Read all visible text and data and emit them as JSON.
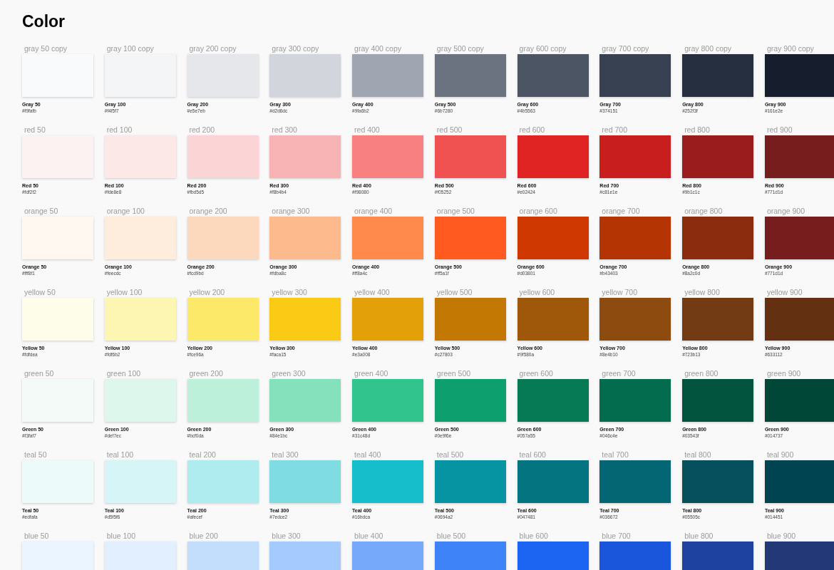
{
  "title": "Color",
  "rows": [
    {
      "swatches": [
        {
          "label": "gray 50 copy",
          "name": "Gray 50",
          "hex": "#f9fafb",
          "color": "#f9fafb"
        },
        {
          "label": "gray 100 copy",
          "name": "Gray 100",
          "hex": "#f4f5f7",
          "color": "#f4f5f7"
        },
        {
          "label": "gray 200 copy",
          "name": "Gray 200",
          "hex": "#e5e7eb",
          "color": "#e5e7eb"
        },
        {
          "label": "gray 300 copy",
          "name": "Gray 300",
          "hex": "#d2d6dc",
          "color": "#d2d6dc"
        },
        {
          "label": "gray 400 copy",
          "name": "Gray 400",
          "hex": "#9fa6b2",
          "color": "#9fa6b2"
        },
        {
          "label": "gray 500 copy",
          "name": "Gray 500",
          "hex": "#6b7280",
          "color": "#6b7280"
        },
        {
          "label": "gray 600 copy",
          "name": "Gray 600",
          "hex": "#4b5563",
          "color": "#4b5563"
        },
        {
          "label": "gray 700 copy",
          "name": "Gray 700",
          "hex": "#374151",
          "color": "#374151"
        },
        {
          "label": "gray 800 copy",
          "name": "Gray 800",
          "hex": "#252f3f",
          "color": "#252f3f"
        },
        {
          "label": "gray 900 copy",
          "name": "Gray 900",
          "hex": "#161e2e",
          "color": "#161e2e"
        }
      ]
    },
    {
      "swatches": [
        {
          "label": "red 50",
          "name": "Red 50",
          "hex": "#fdf2f2",
          "color": "#fdf2f2"
        },
        {
          "label": "red 100",
          "name": "Red 100",
          "hex": "#fde8e8",
          "color": "#fde8e8"
        },
        {
          "label": "red 200",
          "name": "Red 200",
          "hex": "#fbd5d5",
          "color": "#fbd5d5"
        },
        {
          "label": "red 300",
          "name": "Red 300",
          "hex": "#f8b4b4",
          "color": "#f8b4b4"
        },
        {
          "label": "red 400",
          "name": "Red 400",
          "hex": "#f98080",
          "color": "#f98080"
        },
        {
          "label": "red 500",
          "name": "Red 500",
          "hex": "#f05252",
          "color": "#f05252"
        },
        {
          "label": "red 600",
          "name": "Red 600",
          "hex": "#e02424",
          "color": "#e02424"
        },
        {
          "label": "red 700",
          "name": "Red 700",
          "hex": "#c81e1e",
          "color": "#c81e1e"
        },
        {
          "label": "red 800",
          "name": "Red 800",
          "hex": "#9b1c1c",
          "color": "#9b1c1c"
        },
        {
          "label": "red 900",
          "name": "Red 900",
          "hex": "#771d1d",
          "color": "#771d1d"
        }
      ]
    },
    {
      "swatches": [
        {
          "label": "orange 50",
          "name": "Orange 50",
          "hex": "#fff8f1",
          "color": "#fff8f1"
        },
        {
          "label": "orange 100",
          "name": "Orange 100",
          "hex": "#feecdc",
          "color": "#feecdc"
        },
        {
          "label": "orange 200",
          "name": "Orange 200",
          "hex": "#fcd9bd",
          "color": "#fcd9bd"
        },
        {
          "label": "orange 300",
          "name": "Orange 300",
          "hex": "#fdba8c",
          "color": "#fdba8c"
        },
        {
          "label": "orange 400",
          "name": "Orange 400",
          "hex": "#ff8a4c",
          "color": "#ff8a4c"
        },
        {
          "label": "orange 500",
          "name": "Orange 500",
          "hex": "#ff5a1f",
          "color": "#ff5a1f"
        },
        {
          "label": "orange 600",
          "name": "Orange 600",
          "hex": "#d03801",
          "color": "#d03801"
        },
        {
          "label": "orange 700",
          "name": "Orange 700",
          "hex": "#b43403",
          "color": "#b43403"
        },
        {
          "label": "orange 800",
          "name": "Orange 800",
          "hex": "#8a2c0d",
          "color": "#8a2c0d"
        },
        {
          "label": "orange 900",
          "name": "Orange 900",
          "hex": "#771d1d",
          "color": "#771d1d"
        }
      ]
    },
    {
      "swatches": [
        {
          "label": "yellow 50",
          "name": "Yellow 50",
          "hex": "#fdfdea",
          "color": "#fdfdea"
        },
        {
          "label": "yellow 100",
          "name": "Yellow 100",
          "hex": "#fdf6b2",
          "color": "#fdf6b2"
        },
        {
          "label": "yellow 200",
          "name": "Yellow 200",
          "hex": "#fce96a",
          "color": "#fce96a"
        },
        {
          "label": "yellow 300",
          "name": "Yellow 300",
          "hex": "#faca15",
          "color": "#faca15"
        },
        {
          "label": "yellow 400",
          "name": "Yellow 400",
          "hex": "#e3a008",
          "color": "#e3a008"
        },
        {
          "label": "yellow 500",
          "name": "Yellow 500",
          "hex": "#c27803",
          "color": "#c27803"
        },
        {
          "label": "yellow 600",
          "name": "Yellow 600",
          "hex": "#9f580a",
          "color": "#9f580a"
        },
        {
          "label": "yellow 700",
          "name": "Yellow 700",
          "hex": "#8e4b10",
          "color": "#8e4b10"
        },
        {
          "label": "yellow 800",
          "name": "Yellow 800",
          "hex": "#723b13",
          "color": "#723b13"
        },
        {
          "label": "yellow 900",
          "name": "Yellow 900",
          "hex": "#633112",
          "color": "#633112"
        }
      ]
    },
    {
      "swatches": [
        {
          "label": "green 50",
          "name": "Green 50",
          "hex": "#f3faf7",
          "color": "#f3faf7"
        },
        {
          "label": "green 100",
          "name": "Green 100",
          "hex": "#def7ec",
          "color": "#def7ec"
        },
        {
          "label": "green 200",
          "name": "Green 200",
          "hex": "#bcf0da",
          "color": "#bcf0da"
        },
        {
          "label": "green 300",
          "name": "Green 300",
          "hex": "#84e1bc",
          "color": "#84e1bc"
        },
        {
          "label": "green 400",
          "name": "Green 400",
          "hex": "#31c48d",
          "color": "#31c48d"
        },
        {
          "label": "green 500",
          "name": "Green 500",
          "hex": "#0e9f6e",
          "color": "#0e9f6e"
        },
        {
          "label": "green 600",
          "name": "Green 600",
          "hex": "#057a55",
          "color": "#057a55"
        },
        {
          "label": "green 700",
          "name": "Green 700",
          "hex": "#046c4e",
          "color": "#046c4e"
        },
        {
          "label": "green 800",
          "name": "Green 800",
          "hex": "#03543f",
          "color": "#03543f"
        },
        {
          "label": "green 900",
          "name": "Green 900",
          "hex": "#014737",
          "color": "#014737"
        }
      ]
    },
    {
      "swatches": [
        {
          "label": "teal 50",
          "name": "Teal 50",
          "hex": "#edfafa",
          "color": "#edfafa"
        },
        {
          "label": "teal 100",
          "name": "Teal 100",
          "hex": "#d5f5f6",
          "color": "#d5f5f6"
        },
        {
          "label": "teal 200",
          "name": "Teal 200",
          "hex": "#afecef",
          "color": "#afecef"
        },
        {
          "label": "teal 300",
          "name": "Teal 300",
          "hex": "#7edce2",
          "color": "#7edce2"
        },
        {
          "label": "teal 400",
          "name": "Teal 400",
          "hex": "#16bdca",
          "color": "#16bdca"
        },
        {
          "label": "teal 500",
          "name": "Teal 500",
          "hex": "#0694a2",
          "color": "#0694a2"
        },
        {
          "label": "teal 600",
          "name": "Teal 600",
          "hex": "#047481",
          "color": "#047481"
        },
        {
          "label": "teal 700",
          "name": "Teal 700",
          "hex": "#036672",
          "color": "#036672"
        },
        {
          "label": "teal 800",
          "name": "Teal 800",
          "hex": "#05505c",
          "color": "#05505c"
        },
        {
          "label": "teal 900",
          "name": "Teal 900",
          "hex": "#014451",
          "color": "#014451"
        }
      ]
    },
    {
      "swatches": [
        {
          "label": "blue 50",
          "color": "#ebf5ff"
        },
        {
          "label": "blue 100",
          "color": "#e1effe"
        },
        {
          "label": "blue 200",
          "color": "#c3ddfd"
        },
        {
          "label": "blue 300",
          "color": "#a4cafe"
        },
        {
          "label": "blue 400",
          "color": "#76a9fa"
        },
        {
          "label": "blue 500",
          "color": "#3f83f8"
        },
        {
          "label": "blue 600",
          "color": "#1c64f2"
        },
        {
          "label": "blue 700",
          "color": "#1a56db"
        },
        {
          "label": "blue 800",
          "color": "#1e429f"
        },
        {
          "label": "blue 900",
          "color": "#233876"
        }
      ]
    }
  ]
}
